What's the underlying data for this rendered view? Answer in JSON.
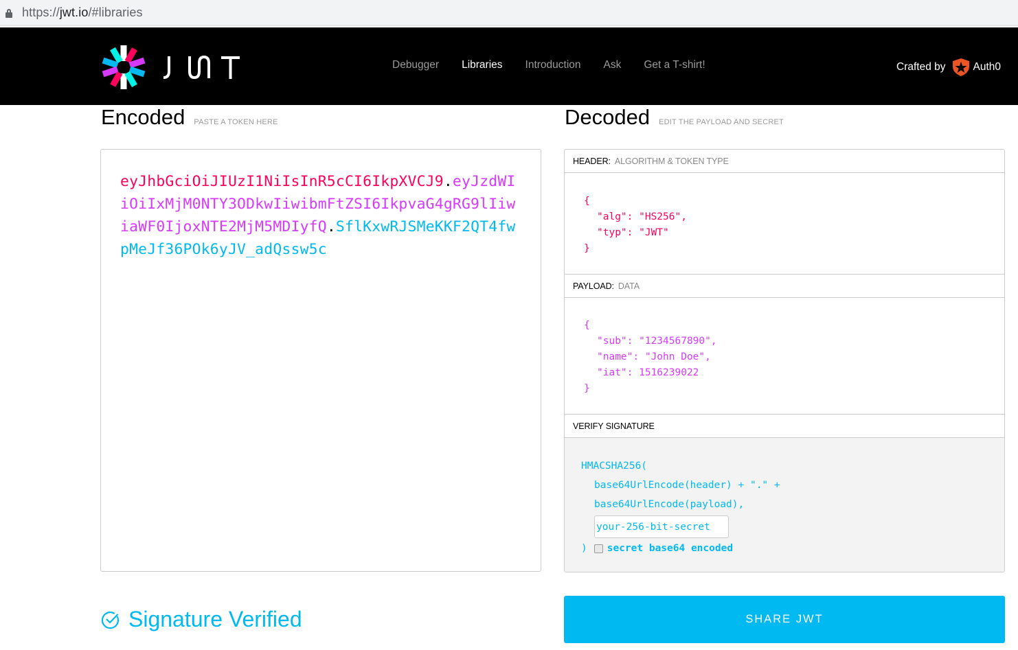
{
  "browser": {
    "url_scheme": "https://",
    "url_host": "jwt.io",
    "url_path": "/#libraries"
  },
  "nav": {
    "brand": "JWT",
    "links": [
      {
        "label": "Debugger",
        "active": false
      },
      {
        "label": "Libraries",
        "active": true
      },
      {
        "label": "Introduction",
        "active": false
      },
      {
        "label": "Ask",
        "active": false
      },
      {
        "label": "Get a T-shirt!",
        "active": false
      }
    ],
    "crafted_by": "Crafted by",
    "crafted_brand": "Auth0"
  },
  "encoded": {
    "title": "Encoded",
    "subtitle": "PASTE A TOKEN HERE",
    "token_header": "eyJhbGciOiJIUzI1NiIsInR5cCI6IkpXVCJ9",
    "token_payload": "eyJzdWIiOiIxMjM0NTY3ODkwIiwibmFtZSI6IkpvaG4gRG9lIiwiaWF0IjoxNTE2MjM5MDIyfQ",
    "token_signature": "SflKxwRJSMeKKF2QT4fwpMeJf36POk6yJV_adQssw5c",
    "dot": "."
  },
  "decoded": {
    "title": "Decoded",
    "subtitle": "EDIT THE PAYLOAD AND SECRET",
    "header": {
      "label": "HEADER:",
      "sublabel": "ALGORITHM & TOKEN TYPE",
      "lines": [
        "{",
        "\"alg\": \"HS256\",",
        "\"typ\": \"JWT\"",
        "}"
      ]
    },
    "payload": {
      "label": "PAYLOAD:",
      "sublabel": "DATA",
      "lines": [
        "{",
        "\"sub\": \"1234567890\",",
        "\"name\": \"John Doe\",",
        "\"iat\": 1516239022",
        "}"
      ]
    },
    "signature": {
      "label": "VERIFY SIGNATURE",
      "fn_open": "HMACSHA256(",
      "line1": "base64UrlEncode(header) + \".\" +",
      "line2": "base64UrlEncode(payload),",
      "secret_value": "your-256-bit-secret",
      "fn_close": ")",
      "checkbox_label": "secret base64 encoded",
      "checkbox_checked": false
    }
  },
  "status": {
    "text": "Signature Verified",
    "icon": "check-circle-icon"
  },
  "share_button": "SHARE JWT",
  "colors": {
    "header": "#fb015b",
    "payload": "#d63aff",
    "signature": "#00b9f1"
  }
}
